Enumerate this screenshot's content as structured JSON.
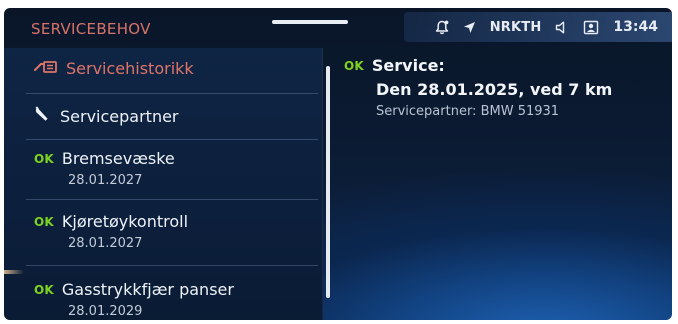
{
  "header": {
    "title": "SERVICEBEHOV"
  },
  "status_bar": {
    "radio_station": "NRKTH",
    "clock": "13:44",
    "icons": [
      "notification-bell-icon",
      "navigation-arrow-icon",
      "speaker-muted-icon",
      "contact-card-icon"
    ]
  },
  "list": {
    "items": [
      {
        "icon": "service-history-icon",
        "label": "Servicehistorikk"
      },
      {
        "icon": "wrench-icon",
        "label": "Servicepartner"
      },
      {
        "badge": "OK",
        "label": "Bremsevæske",
        "date": "28.01.2027"
      },
      {
        "badge": "OK",
        "label": "Kjøretøykontroll",
        "date": "28.01.2027"
      },
      {
        "badge": "OK",
        "label": "Gasstrykkfjær panser",
        "date": "28.01.2029"
      }
    ]
  },
  "detail": {
    "badge": "OK",
    "title": "Service:",
    "line": "Den 28.01.2025, ved 7 km",
    "sub": "Servicepartner: BMW 51931"
  },
  "colors": {
    "accent": "#e07368",
    "ok_green": "#7ed321",
    "background": "#0b1b33"
  }
}
